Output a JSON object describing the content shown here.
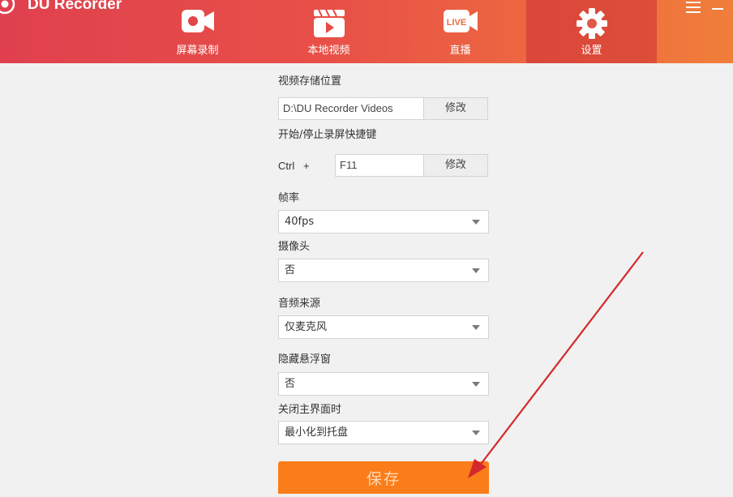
{
  "app": {
    "title": "DU Recorder"
  },
  "nav": {
    "tabs": [
      {
        "label": "屏幕录制",
        "icon": "video-camera-icon"
      },
      {
        "label": "本地视频",
        "icon": "clapperboard-play-icon"
      },
      {
        "label": "直播",
        "icon": "live-camera-icon",
        "badge": "LIVE"
      },
      {
        "label": "设置",
        "icon": "gear-icon",
        "active": true
      }
    ]
  },
  "window_controls": {
    "menu_icon": "hamburger-menu-icon",
    "minimize_icon": "minimize-icon"
  },
  "settings": {
    "storage": {
      "label": "视频存储位置",
      "value": "D:\\DU Recorder Videos",
      "button": "修改"
    },
    "hotkey": {
      "label": "开始/停止录屏快捷键",
      "modifier": "Ctrl   +",
      "value": "F11",
      "button": "修改"
    },
    "framerate": {
      "label": "帧率",
      "value": "40fps"
    },
    "camera": {
      "label": "摄像头",
      "value": "否"
    },
    "audio_source": {
      "label": "音频来源",
      "value": "仅麦克风"
    },
    "hide_float": {
      "label": "隐藏悬浮窗",
      "value": "否"
    },
    "on_close": {
      "label": "关闭主界面时",
      "value": "最小化到托盘"
    },
    "save_button": "保存"
  },
  "colors": {
    "header_start": "#e0404e",
    "header_end": "#f07e3a",
    "save_button": "#fb7d1a",
    "annotation_arrow": "#d4282c"
  }
}
